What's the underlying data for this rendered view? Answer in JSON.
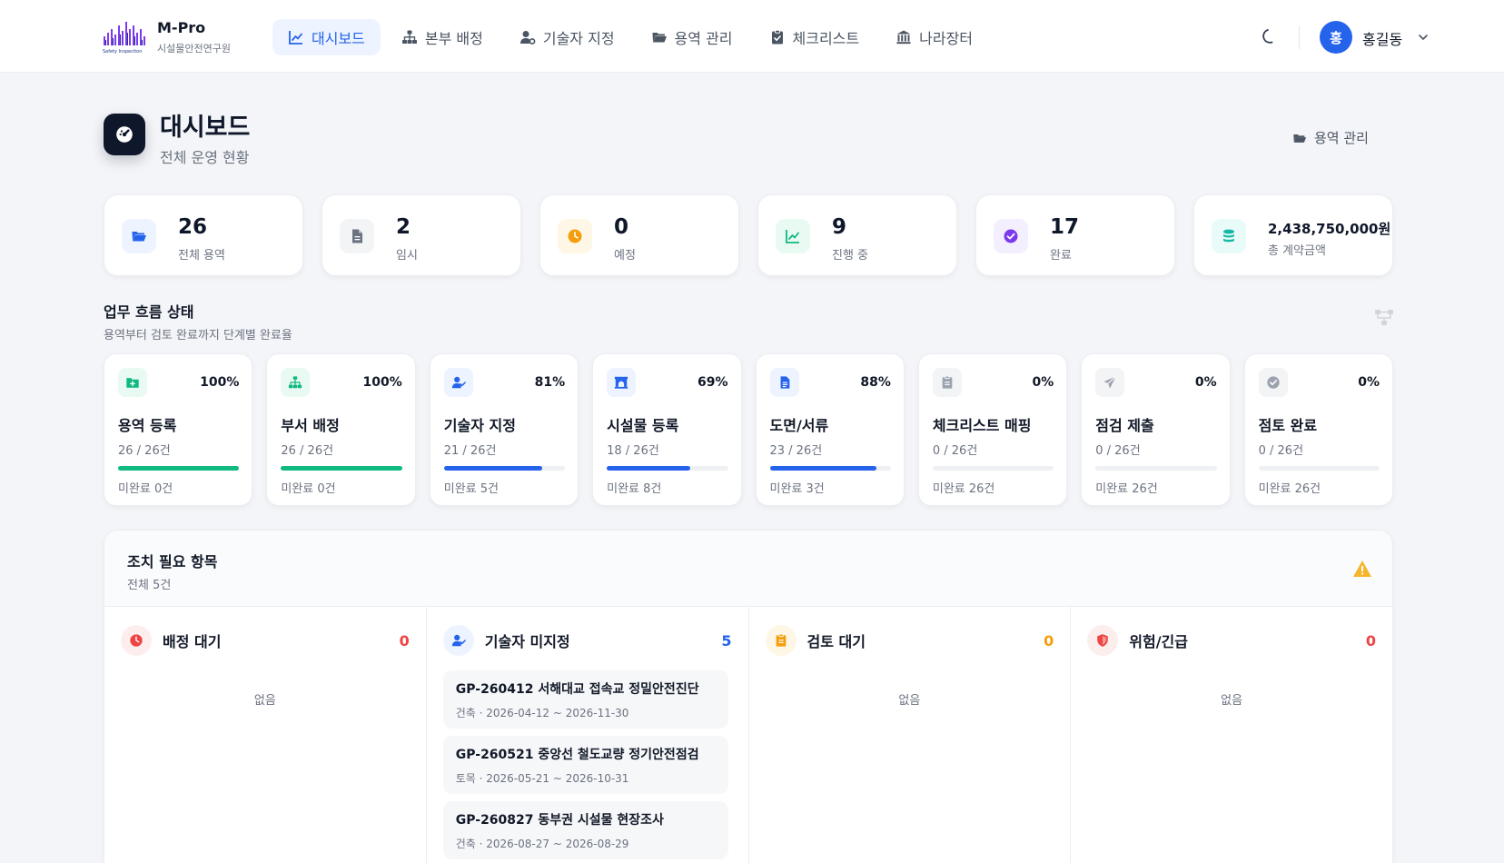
{
  "app": {
    "logo_title": "M-Pro",
    "logo_subtitle": "시설물안전연구원",
    "logo_mark_text": "Safety Inspection"
  },
  "nav": {
    "items": [
      {
        "label": "대시보드",
        "icon": "chart-line-icon",
        "active": true
      },
      {
        "label": "본부 배정",
        "icon": "sitemap-icon",
        "active": false
      },
      {
        "label": "기술자 지정",
        "icon": "user-gear-icon",
        "active": false
      },
      {
        "label": "용역 관리",
        "icon": "folder-open-icon",
        "active": false
      },
      {
        "label": "체크리스트",
        "icon": "clipboard-check-icon",
        "active": false
      },
      {
        "label": "나라장터",
        "icon": "building-columns-icon",
        "active": false
      }
    ]
  },
  "user": {
    "avatar_initial": "홍",
    "name": "홍길동"
  },
  "header": {
    "title": "대시보드",
    "subtitle": "전체 운영 현황",
    "link_label": "용역 관리"
  },
  "stats": [
    {
      "value": "26",
      "label": "전체 용역",
      "icon": "folder-open-icon",
      "color": "#2563eb",
      "bg": "#eef4ff"
    },
    {
      "value": "2",
      "label": "임시",
      "icon": "file-icon",
      "color": "#6b7280",
      "bg": "#f3f4f6"
    },
    {
      "value": "0",
      "label": "예정",
      "icon": "clock-icon",
      "color": "#f59e0b",
      "bg": "#fff7e6"
    },
    {
      "value": "9",
      "label": "진행 중",
      "icon": "chart-line-icon",
      "color": "#10b981",
      "bg": "#e9faf3"
    },
    {
      "value": "17",
      "label": "완료",
      "icon": "check-circle-icon",
      "color": "#7c3aed",
      "bg": "#f3efff"
    },
    {
      "value": "2,438,750,000원",
      "label": "총 계약금액",
      "icon": "coins-icon",
      "color": "#14b8a6",
      "bg": "#e8fbf8"
    }
  ],
  "workflow": {
    "title": "업무 흐름 상태",
    "subtitle": "용역부터 검토 완료까지 단계별 완료율",
    "steps": [
      {
        "name": "용역 등록",
        "percent_label": "100%",
        "percent": 100,
        "count": "26 / 26건",
        "remaining": "미완료 0건",
        "color": "#10b981",
        "bg": "#e9faf3",
        "icon": "folder-plus-icon"
      },
      {
        "name": "부서 배정",
        "percent_label": "100%",
        "percent": 100,
        "count": "26 / 26건",
        "remaining": "미완료 0건",
        "color": "#10b981",
        "bg": "#e9faf3",
        "icon": "sitemap-icon"
      },
      {
        "name": "기술자 지정",
        "percent_label": "81%",
        "percent": 81,
        "count": "21 / 26건",
        "remaining": "미완료 5건",
        "color": "#2563eb",
        "bg": "#eef4ff",
        "icon": "user-check-icon"
      },
      {
        "name": "시설물 등록",
        "percent_label": "69%",
        "percent": 69,
        "count": "18 / 26건",
        "remaining": "미완료 8건",
        "color": "#2563eb",
        "bg": "#eef4ff",
        "icon": "archway-icon"
      },
      {
        "name": "도면/서류",
        "percent_label": "88%",
        "percent": 88,
        "count": "23 / 26건",
        "remaining": "미완료 3건",
        "color": "#2563eb",
        "bg": "#eef4ff",
        "icon": "file-lines-icon"
      },
      {
        "name": "체크리스트 매핑",
        "percent_label": "0%",
        "percent": 0,
        "count": "0 / 26건",
        "remaining": "미완료 26건",
        "color": "#9ca3af",
        "bg": "#f3f4f6",
        "icon": "clipboard-icon"
      },
      {
        "name": "점검 제출",
        "percent_label": "0%",
        "percent": 0,
        "count": "0 / 26건",
        "remaining": "미완료 26건",
        "color": "#9ca3af",
        "bg": "#f3f4f6",
        "icon": "paper-plane-icon"
      },
      {
        "name": "점토 완료",
        "percent_label": "0%",
        "percent": 0,
        "count": "0 / 26건",
        "remaining": "미완료 26건",
        "color": "#9ca3af",
        "bg": "#f3f4f6",
        "icon": "check-circle-icon"
      }
    ]
  },
  "actions": {
    "title": "조치 필요 항목",
    "subtitle": "전체 5건",
    "columns": [
      {
        "title": "배정 대기",
        "count": "0",
        "count_color": "#ef4444",
        "icon": "clock-icon",
        "icon_color": "#ef4444",
        "icon_bg": "#fdeeee",
        "empty": "없음",
        "items": []
      },
      {
        "title": "기술자 미지정",
        "count": "5",
        "count_color": "#2563eb",
        "icon": "user-check-icon",
        "icon_color": "#2563eb",
        "icon_bg": "#eef4ff",
        "empty": "",
        "items": [
          {
            "title": "GP-260412 서해대교 접속교 정밀안전진단",
            "meta": "건축 · 2026-04-12 ~ 2026-11-30"
          },
          {
            "title": "GP-260521 중앙선 철도교량 정기안전점검",
            "meta": "토목 · 2026-05-21 ~ 2026-10-31"
          },
          {
            "title": "GP-260827 동부권 시설물 현장조사",
            "meta": "건축 · 2026-08-27 ~ 2026-08-29"
          }
        ]
      },
      {
        "title": "검토 대기",
        "count": "0",
        "count_color": "#f59e0b",
        "icon": "clipboard-icon",
        "icon_color": "#f59e0b",
        "icon_bg": "#fff7e6",
        "empty": "없음",
        "items": []
      },
      {
        "title": "위험/긴급",
        "count": "0",
        "count_color": "#ef4444",
        "icon": "shield-icon",
        "icon_color": "#ef4444",
        "icon_bg": "#fdeeee",
        "empty": "없음",
        "items": []
      }
    ]
  }
}
